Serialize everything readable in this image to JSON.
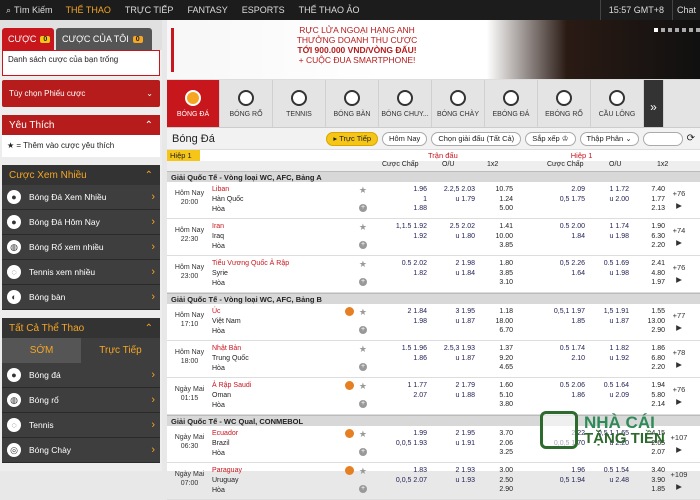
{
  "topbar": {
    "search": "Tìm Kiếm",
    "nav": [
      "THỂ THAO",
      "TRỰC TIẾP",
      "FANTASY",
      "ESPORTS",
      "THỂ THAO ẢO"
    ],
    "time": "15:57 GMT+8",
    "chat": "Chat"
  },
  "left": {
    "tab_bet": "CƯỢC",
    "tab_bet_count": "0",
    "tab_my": "CƯỢC CỦA TÔI",
    "tab_my_count": "0",
    "betslip_empty": "Danh sách cược của bạn trống",
    "options": "Tùy chọn Phiếu cược",
    "fav_title": "Yêu Thích",
    "fav_hint": "★ = Thêm vào cược yêu thích",
    "popular_title": "Cược Xem Nhiều",
    "popular": [
      "Bóng Đá Xem Nhiều",
      "Bóng Đá Hôm Nay",
      "Bóng Rổ xem nhiều",
      "Tennis xem nhiều",
      "Bóng bàn"
    ],
    "all_title": "Tất Cả Thể Thao",
    "tab_early": "SỚM",
    "tab_live": "Trực Tiếp",
    "all": [
      "Bóng đá",
      "Bóng rổ",
      "Tennis",
      "Bóng Chày"
    ]
  },
  "banner": {
    "l1": "RỰC LỬA NGOẠI HẠNG ANH",
    "l2": "THƯỞNG DOANH THU CƯỢC",
    "l3": "TỚI 900.000 VND/VÒNG ĐẤU!",
    "l4": "+ CUỘC ĐUA SMARTPHONE!"
  },
  "sports": [
    "BÓNG ĐÁ",
    "BÓNG RỔ",
    "TENNIS",
    "BÓNG BÀN",
    "BÓNG CHUY...",
    "BÓNG CHÀY",
    "EBÓNG ĐÁ",
    "EBÓNG RỔ",
    "CẦU LÔNG"
  ],
  "filter": {
    "title": "Bóng Đá",
    "live": "Trực Tiếp",
    "today": "Hôm Nay",
    "league": "Chọn giải đấu (Tất Cả)",
    "sort": "Sắp xếp",
    "odds": "Thập Phân"
  },
  "table": {
    "half": "Hiệp 1",
    "match": "Trận đấu",
    "h1": "Hiệp 1",
    "cols": [
      "Cược Chấp",
      "O/U",
      "1x2",
      "Cược Chấp",
      "O/U",
      "1x2"
    ]
  },
  "leagues": [
    {
      "name": "Giải Quốc Tế - Vòng loại WC, AFC, Bảng A",
      "matches": [
        {
          "d": "Hôm Nay",
          "t": "20:00",
          "home": "Liban",
          "away": "Hàn Quốc",
          "draw": "Hòa",
          "s": false,
          "hc": [
            "",
            "1.96",
            "1",
            "1.88"
          ],
          "ou": [
            "2.2,5 2.03",
            "u 1.79"
          ],
          "x": [
            "10.75",
            "1.24",
            "5.00"
          ],
          "hc2": [
            "",
            "2.09",
            "0,5 1.75"
          ],
          "ou2": [
            "1 1.72",
            "u 2.00"
          ],
          "x2": [
            "7.40",
            "1.77",
            "2.13"
          ],
          "more": "+76"
        },
        {
          "d": "Hôm Nay",
          "t": "22:30",
          "home": "Iran",
          "away": "Iraq",
          "draw": "Hòa",
          "s": false,
          "hc": [
            "1,1.5 1.92",
            "1.92"
          ],
          "ou": [
            "2.5 2.02",
            "u 1.80"
          ],
          "x": [
            "1.41",
            "10.00",
            "3.85"
          ],
          "hc2": [
            "0.5 2.00",
            "1.84"
          ],
          "ou2": [
            "1 1.74",
            "u 1.98"
          ],
          "x2": [
            "1.90",
            "6.30",
            "2.20"
          ],
          "more": "+74"
        },
        {
          "d": "Hôm Nay",
          "t": "23:00",
          "home": "Tiểu Vương Quốc Ả Rập",
          "away": "Syrie",
          "draw": "Hòa",
          "s": false,
          "hc": [
            "0.5 2.02",
            "1.82"
          ],
          "ou": [
            "2 1.98",
            "u 1.84"
          ],
          "x": [
            "1.80",
            "3.85",
            "3.10"
          ],
          "hc2": [
            "0,5 2.26",
            "1.64"
          ],
          "ou2": [
            "0.5 1.69",
            "u 1.98"
          ],
          "x2": [
            "2.41",
            "4.80",
            "1.97"
          ],
          "more": "+76"
        }
      ]
    },
    {
      "name": "Giải Quốc Tế - Vòng loại WC, AFC, Bảng B",
      "matches": [
        {
          "d": "Hôm Nay",
          "t": "17:10",
          "home": "Úc",
          "away": "Việt Nam",
          "draw": "Hòa",
          "s": true,
          "hc": [
            "2 1.84",
            "1.98"
          ],
          "ou": [
            "3 1.95",
            "u 1.87"
          ],
          "x": [
            "1.18",
            "18.00",
            "6.70"
          ],
          "hc2": [
            "0,5,1 1.97",
            "1.85"
          ],
          "ou2": [
            "1,5 1.91",
            "u 1.87"
          ],
          "x2": [
            "1.55",
            "13.00",
            "2.90"
          ],
          "more": "+77"
        },
        {
          "d": "Hôm Nay",
          "t": "18:00",
          "home": "Nhật Bản",
          "away": "Trung Quốc",
          "draw": "Hòa",
          "s": false,
          "hc": [
            "1.5 1.96",
            "1.86"
          ],
          "ou": [
            "2.5,3 1.93",
            "u 1.87"
          ],
          "x": [
            "1.37",
            "9.20",
            "4.65"
          ],
          "hc2": [
            "0.5 1.74",
            "2.10"
          ],
          "ou2": [
            "1 1.82",
            "u 1.92"
          ],
          "x2": [
            "1.86",
            "6.80",
            "2.20"
          ],
          "more": "+78"
        },
        {
          "d": "Ngày Mai",
          "t": "01:15",
          "home": "Ả Rập Saudi",
          "away": "Oman",
          "draw": "Hòa",
          "s": true,
          "hc": [
            "1 1.77",
            "2.07"
          ],
          "ou": [
            "2 1.79",
            "u 1.88"
          ],
          "x": [
            "1.60",
            "5.10",
            "3.80"
          ],
          "hc2": [
            "0.5 2.06",
            "1.86"
          ],
          "ou2": [
            "0.5 1.64",
            "u 2.09"
          ],
          "x2": [
            "1.94",
            "5.80",
            "2.14"
          ],
          "more": "+76"
        }
      ]
    },
    {
      "name": "Giải Quốc Tế - WC Qual, CONMEBOL",
      "matches": [
        {
          "d": "Ngày Mai",
          "t": "06:30",
          "home": "Ecuador",
          "away": "Brazil",
          "draw": "Hòa",
          "s": true,
          "hc": [
            "",
            "1.99",
            "0,0,5 1.93"
          ],
          "ou": [
            "2 1.95",
            "u 1.91"
          ],
          "x": [
            "3.70",
            "2.06",
            "3.25"
          ],
          "hc2": [
            "",
            "2.22",
            "0,0,5 1.70"
          ],
          "ou2": [
            "0,5,1 1.65",
            "u 2.20"
          ],
          "x2": [
            "4.15",
            "2.65",
            "2.07"
          ],
          "more": "+107"
        },
        {
          "d": "Ngày Mai",
          "t": "07:00",
          "home": "Paraguay",
          "away": "Uruguay",
          "draw": "Hòa",
          "s": true,
          "hc": [
            "",
            "1.83",
            "0,0,5 2.07"
          ],
          "ou": [
            "2 1.93",
            "u 1.93"
          ],
          "x": [
            "3.00",
            "2.50",
            "2.90"
          ],
          "hc2": [
            "",
            "1.96",
            "0,5 1.94"
          ],
          "ou2": [
            "0.5 1.54",
            "u 2.48"
          ],
          "x2": [
            "3.40",
            "3.90",
            "1.85"
          ],
          "more": "+109"
        }
      ]
    }
  ],
  "watermark": {
    "t1": "NHÀ CÁI",
    "t2": "TẶNG TIỀN"
  }
}
